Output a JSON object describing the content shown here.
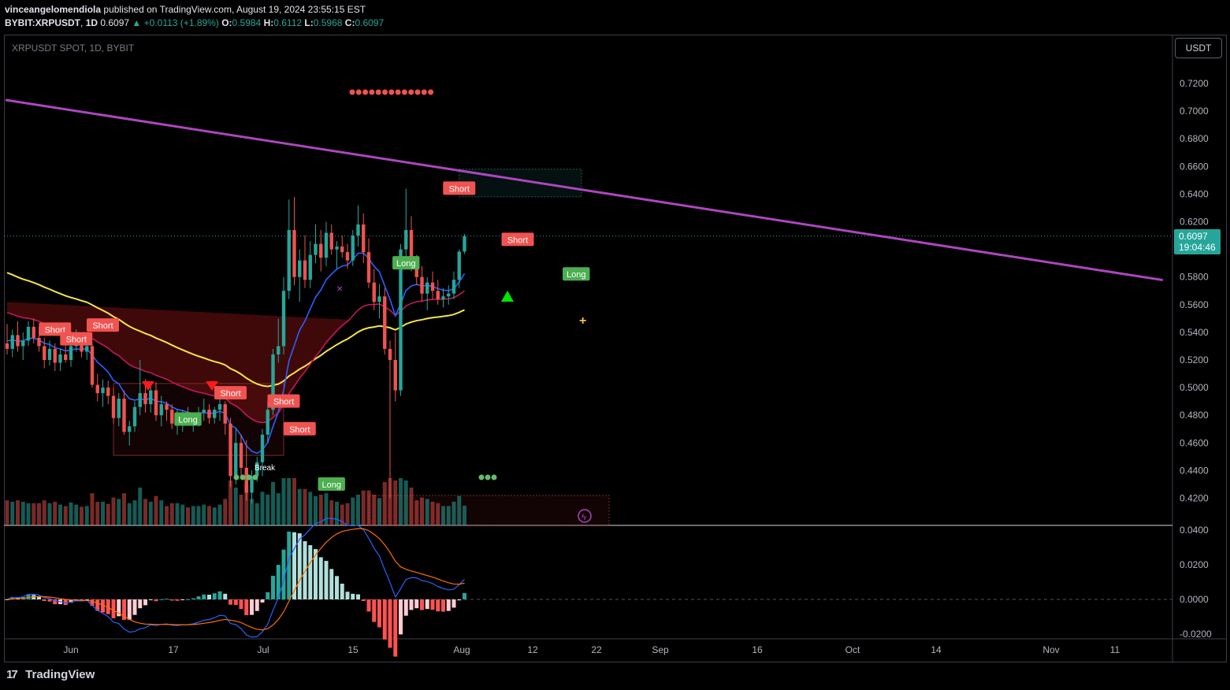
{
  "header": {
    "publisher": "vinceangelomendiola",
    "published_text": "published on TradingView.com, August 19, 2024 23:55:15 EST",
    "symbol": "BYBIT:XRPUSDT",
    "interval": "1D",
    "last": "0.6097",
    "change": "+0.0113 (+1.89%)",
    "open_label": "O:",
    "open": "0.5984",
    "high_label": "H:",
    "high": "0.6112",
    "low_label": "L:",
    "low": "0.5968",
    "close_label": "C:",
    "close": "0.6097"
  },
  "legend": {
    "symbol_line": "XRPUSDT SPOT, 1D, BYBIT"
  },
  "currency_button": "USDT",
  "price_tag": {
    "price": "0.6097",
    "countdown": "19:04:46"
  },
  "branding": {
    "logo_text": "TradingView",
    "logo_mark": "17"
  },
  "colors": {
    "up": "#26a69a",
    "down": "#ef5350",
    "trendline": "#ab47bc",
    "ema200": "#f5e642",
    "ema_fast": "#2962ff",
    "ema_slow": "#c2185b"
  },
  "chart_data": [
    {
      "type": "candlestick",
      "title": "",
      "x_ticks": [
        "Jun",
        "17",
        "Jul",
        "15",
        "Aug",
        "12",
        "22",
        "Sep",
        "16",
        "Oct",
        "14",
        "Nov",
        "11"
      ],
      "y_ticks": [
        "0.7200",
        "0.7000",
        "0.6800",
        "0.6600",
        "0.6400",
        "0.6200",
        "0.5800",
        "0.5600",
        "0.5400",
        "0.5200",
        "0.5000",
        "0.4800",
        "0.4600",
        "0.4400",
        "0.4200"
      ],
      "ylim": [
        0.4,
        0.74
      ],
      "candles": [
        [
          0.532,
          0.546,
          0.524,
          0.528
        ],
        [
          0.528,
          0.542,
          0.522,
          0.538
        ],
        [
          0.538,
          0.548,
          0.526,
          0.53
        ],
        [
          0.53,
          0.54,
          0.52,
          0.534
        ],
        [
          0.534,
          0.548,
          0.53,
          0.544
        ],
        [
          0.544,
          0.55,
          0.532,
          0.536
        ],
        [
          0.536,
          0.544,
          0.526,
          0.53
        ],
        [
          0.53,
          0.536,
          0.514,
          0.52
        ],
        [
          0.52,
          0.534,
          0.516,
          0.528
        ],
        [
          0.528,
          0.532,
          0.512,
          0.518
        ],
        [
          0.518,
          0.528,
          0.512,
          0.524
        ],
        [
          0.524,
          0.532,
          0.518,
          0.52
        ],
        [
          0.52,
          0.534,
          0.515,
          0.53
        ],
        [
          0.53,
          0.542,
          0.526,
          0.532
        ],
        [
          0.532,
          0.535,
          0.522,
          0.526
        ],
        [
          0.526,
          0.534,
          0.52,
          0.53
        ],
        [
          0.53,
          0.532,
          0.5,
          0.502
        ],
        [
          0.502,
          0.51,
          0.49,
          0.496
        ],
        [
          0.496,
          0.506,
          0.486,
          0.5
        ],
        [
          0.5,
          0.505,
          0.488,
          0.494
        ],
        [
          0.494,
          0.5,
          0.474,
          0.478
        ],
        [
          0.478,
          0.496,
          0.472,
          0.492
        ],
        [
          0.492,
          0.498,
          0.466,
          0.468
        ],
        [
          0.468,
          0.476,
          0.458,
          0.472
        ],
        [
          0.472,
          0.49,
          0.468,
          0.486
        ],
        [
          0.486,
          0.52,
          0.48,
          0.496
        ],
        [
          0.496,
          0.506,
          0.482,
          0.488
        ],
        [
          0.488,
          0.502,
          0.482,
          0.498
        ],
        [
          0.498,
          0.504,
          0.476,
          0.48
        ],
        [
          0.48,
          0.494,
          0.472,
          0.488
        ],
        [
          0.488,
          0.49,
          0.476,
          0.484
        ],
        [
          0.484,
          0.488,
          0.47,
          0.474
        ],
        [
          0.474,
          0.484,
          0.466,
          0.476
        ],
        [
          0.476,
          0.484,
          0.468,
          0.48
        ],
        [
          0.48,
          0.486,
          0.474,
          0.476
        ],
        [
          0.476,
          0.482,
          0.468,
          0.478
        ],
        [
          0.478,
          0.486,
          0.472,
          0.482
        ],
        [
          0.482,
          0.492,
          0.476,
          0.484
        ],
        [
          0.484,
          0.488,
          0.474,
          0.478
        ],
        [
          0.478,
          0.486,
          0.474,
          0.484
        ],
        [
          0.484,
          0.492,
          0.476,
          0.488
        ],
        [
          0.488,
          0.49,
          0.466,
          0.474
        ],
        [
          0.474,
          0.478,
          0.428,
          0.436
        ],
        [
          0.436,
          0.47,
          0.43,
          0.46
        ],
        [
          0.46,
          0.466,
          0.436,
          0.442
        ],
        [
          0.442,
          0.462,
          0.418,
          0.424
        ],
        [
          0.424,
          0.44,
          0.416,
          0.436
        ],
        [
          0.436,
          0.45,
          0.432,
          0.446
        ],
        [
          0.446,
          0.47,
          0.436,
          0.466
        ],
        [
          0.466,
          0.49,
          0.46,
          0.484
        ],
        [
          0.484,
          0.528,
          0.48,
          0.524
        ],
        [
          0.524,
          0.55,
          0.518,
          0.53
        ],
        [
          0.53,
          0.58,
          0.524,
          0.57
        ],
        [
          0.57,
          0.636,
          0.564,
          0.614
        ],
        [
          0.614,
          0.638,
          0.574,
          0.58
        ],
        [
          0.58,
          0.6,
          0.562,
          0.592
        ],
        [
          0.592,
          0.61,
          0.572,
          0.578
        ],
        [
          0.578,
          0.606,
          0.572,
          0.596
        ],
        [
          0.596,
          0.618,
          0.59,
          0.604
        ],
        [
          0.604,
          0.614,
          0.584,
          0.594
        ],
        [
          0.594,
          0.62,
          0.588,
          0.612
        ],
        [
          0.612,
          0.618,
          0.596,
          0.6
        ],
        [
          0.6,
          0.606,
          0.586,
          0.602
        ],
        [
          0.602,
          0.61,
          0.594,
          0.598
        ],
        [
          0.598,
          0.604,
          0.586,
          0.592
        ],
        [
          0.592,
          0.614,
          0.588,
          0.61
        ],
        [
          0.61,
          0.632,
          0.602,
          0.618
        ],
        [
          0.618,
          0.626,
          0.59,
          0.598
        ],
        [
          0.598,
          0.608,
          0.572,
          0.576
        ],
        [
          0.576,
          0.586,
          0.556,
          0.562
        ],
        [
          0.562,
          0.575,
          0.55,
          0.566
        ],
        [
          0.566,
          0.572,
          0.524,
          0.528
        ],
        [
          0.528,
          0.534,
          0.42,
          0.52
        ],
        [
          0.52,
          0.54,
          0.49,
          0.498
        ],
        [
          0.498,
          0.604,
          0.494,
          0.6
        ],
        [
          0.6,
          0.644,
          0.594,
          0.614
        ],
        [
          0.614,
          0.624,
          0.584,
          0.588
        ],
        [
          0.588,
          0.596,
          0.574,
          0.58
        ],
        [
          0.58,
          0.588,
          0.562,
          0.568
        ],
        [
          0.568,
          0.58,
          0.556,
          0.576
        ],
        [
          0.576,
          0.584,
          0.564,
          0.57
        ],
        [
          0.57,
          0.578,
          0.56,
          0.564
        ],
        [
          0.564,
          0.572,
          0.558,
          0.566
        ],
        [
          0.566,
          0.574,
          0.56,
          0.568
        ],
        [
          0.568,
          0.584,
          0.564,
          0.578
        ],
        [
          0.578,
          0.6,
          0.572,
          0.5984
        ],
        [
          0.5984,
          0.6112,
          0.5968,
          0.6097
        ]
      ],
      "signals": [
        {
          "label": "Short",
          "kind": "short",
          "i": 9,
          "price": 0.542
        },
        {
          "label": "Short",
          "kind": "short",
          "i": 13,
          "price": 0.535
        },
        {
          "label": "Short",
          "kind": "short",
          "i": 18,
          "price": 0.545
        },
        {
          "label": "Long",
          "kind": "long",
          "i": 34,
          "price": 0.477
        },
        {
          "label": "Short",
          "kind": "short",
          "i": 42,
          "price": 0.496
        },
        {
          "label": "Short",
          "kind": "short",
          "i": 52,
          "price": 0.49
        },
        {
          "label": "Short",
          "kind": "short",
          "i": 55,
          "price": 0.47
        },
        {
          "label": "Long",
          "kind": "long",
          "i": 61,
          "price": 0.43
        },
        {
          "label": "Long",
          "kind": "long",
          "i": 75,
          "price": 0.59
        },
        {
          "label": "Short",
          "kind": "short",
          "i": 85,
          "price": 0.644
        },
        {
          "label": "Short",
          "kind": "short",
          "i": 96,
          "price": 0.607
        },
        {
          "label": "Long",
          "kind": "long",
          "i": 107,
          "price": 0.582
        }
      ],
      "annotation": {
        "label": "Break"
      },
      "trendline": {
        "from": [
          0,
          0.7081
        ],
        "to": [
          217,
          0.5778
        ]
      }
    },
    {
      "type": "macd",
      "y_ticks": [
        "0.0400",
        "0.0200",
        "0.0000",
        "-0.0200"
      ],
      "ylim": [
        -0.025,
        0.045
      ]
    }
  ]
}
